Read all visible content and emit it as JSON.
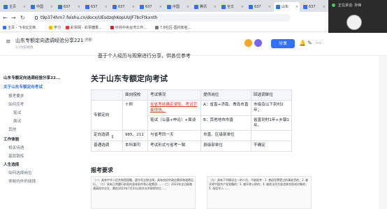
{
  "browser": {
    "tabs": [
      {
        "label": "主页",
        "active": false
      },
      {
        "label": "中国",
        "active": false
      },
      {
        "label": "637",
        "active": false
      },
      {
        "label": "637",
        "active": false
      },
      {
        "label": "637",
        "active": false
      },
      {
        "label": "637",
        "active": false
      },
      {
        "label": "中国",
        "active": false
      },
      {
        "label": "腾讯",
        "active": false
      },
      {
        "label": "全文",
        "active": false
      },
      {
        "label": "637",
        "active": false
      },
      {
        "label": "山东",
        "active": true
      },
      {
        "label": "637",
        "active": false
      }
    ],
    "url": "t9p374hrn7.feishu.cn/docx/UEsdzqhKopUUJF7bcFtkxnth",
    "bookmarks": [
      "主页 - 飞书云文档",
      "学习",
      "彩票网 - 彩票糖果...",
      "中共中央台湾工作...",
      "7.8社区-国内知名..."
    ]
  },
  "doc": {
    "title": "山东专额定向选调经验分享221023",
    "external": "外部",
    "meta": "2小时前修改",
    "share_label": "分享",
    "banner": "基于个人经历与观察进行分享，供各位参考",
    "heading": "关于山东专额定向考试",
    "table": {
      "headers": [
        "",
        "面向院校",
        "考试情况",
        "提供岗位",
        "回选调单位"
      ],
      "rows": [
        [
          "专额定向",
          "十所",
          "在省考前确定录取，考试节奏很快。",
          "A：省直+济南、青岛市直",
          "市级及以下到村2年；"
        ],
        [
          "",
          "",
          "笔试（公基+申论）+面谈",
          "B：其他地市市直",
          "省直到村1年+乡镇1年。"
        ],
        [
          "定向选调",
          "985、211",
          "与省考同一天",
          "市直、区级部单位",
          ""
        ],
        [
          "普通选调",
          "本科面可",
          "考试形式与省考一致",
          "县级部单位",
          "不确定"
        ]
      ]
    },
    "section2": "报考要求",
    "img_left": "（一）具有中华人民共和国国籍，遵守宪法和法律，具有良好的政治素质和道德品行。（二）具有正常履行职责的身体条件和心理素质……（三）2023年全日制普通高校毕业生，需在2023年7月31日前毕业并取得学位……",
    "img_right": "（九）具有下列情况之一的人员，不能报考：1. 曾因犯罪受过刑事处罚的；2. 被开除中国共产党党籍的；3. 被开除公职的；4. 被依法列为失信联合惩戒对象的；5. 现役军人……"
  },
  "toc": {
    "items": [
      {
        "label": "山东专额定向选调经验分享22...",
        "level": 0
      },
      {
        "label": "关于山东专额定向考试",
        "level": 0,
        "active": true
      },
      {
        "label": "报考要求",
        "level": 1
      },
      {
        "label": "如何应考",
        "level": 1
      },
      {
        "label": "笔试",
        "level": 2
      },
      {
        "label": "面试",
        "level": 2
      },
      {
        "label": "其他",
        "level": 1
      },
      {
        "label": "工作体验",
        "level": 0
      },
      {
        "label": "相关待遇",
        "level": 1
      },
      {
        "label": "基层锻炼",
        "level": 1
      },
      {
        "label": "人生选择",
        "level": 0
      },
      {
        "label": "如何选择岗位",
        "level": 1
      },
      {
        "label": "体制内外的抉择",
        "level": 1
      }
    ]
  },
  "meeting": {
    "title": "正在讲话: 孙峰",
    "name": "孙峰"
  },
  "colors": {
    "accent": "#3370ff",
    "highlight": "#d83931"
  }
}
